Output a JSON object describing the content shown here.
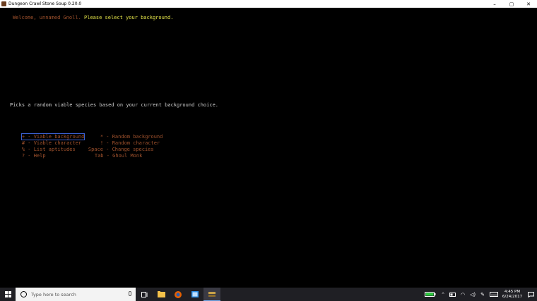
{
  "window": {
    "title": "Dungeon Crawl Stone Soup 0.20.0",
    "controls": {
      "minimize": "–",
      "maximize": "▢",
      "close": "✕"
    }
  },
  "console": {
    "welcome": "Welcome, unnamed Gnoll.",
    "prompt": " Please select your background.",
    "description": "Picks a random viable species based on your current background choice.",
    "menu": [
      {
        "key": "+",
        "label": " - Viable background",
        "right_key": "*",
        "right_label": " - Random background"
      },
      {
        "key": "#",
        "label": " - Viable character",
        "right_key": "!",
        "right_label": " - Random character"
      },
      {
        "key": "%",
        "label": " - List aptitudes",
        "right_key": "Space",
        "right_label": " - Change species"
      },
      {
        "key": "?",
        "label": " - Help",
        "right_key": "Tab",
        "right_label": " - Ghoul Monk"
      }
    ]
  },
  "taskbar": {
    "search_placeholder": "Type here to search",
    "time": "4:45 PM",
    "date": "6/24/2017"
  },
  "colors": {
    "brown": "#a0522d",
    "yellow": "#e8e84a",
    "selection": "#3a5fd0"
  }
}
